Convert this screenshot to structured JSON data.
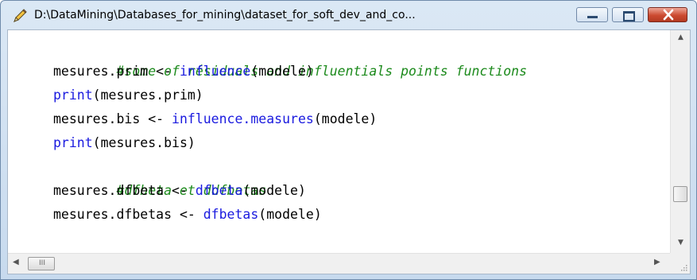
{
  "window": {
    "title": "D:\\DataMining\\Databases_for_mining\\dataset_for_soft_dev_and_co...",
    "icon": "pencil-edit-icon"
  },
  "controls": {
    "minimize_icon": "minimize-icon",
    "maximize_icon": "maximize-icon",
    "close_icon": "close-icon",
    "close_color": "#c9472e"
  },
  "colors": {
    "comment": "#1c8a1c",
    "function": "#1a1adf",
    "text": "#000000"
  },
  "editor": {
    "lines": [
      {
        "comment": "#some of résiduals and influentials points functions"
      },
      {
        "pre": "mesures.prim <- ",
        "fn": "influence",
        "post": "(modele)"
      },
      {
        "pre": "",
        "fn": "print",
        "post": "(mesures.prim)"
      },
      {
        "pre": "mesures.bis <- ",
        "fn": "influence.measures",
        "post": "(modele)"
      },
      {
        "pre": "",
        "fn": "print",
        "post": "(mesures.bis)"
      },
      {
        "comment": "#dfbeta et ddfbetas"
      },
      {
        "pre": "mesures.dfbeta <- ",
        "fn": "dfbeta",
        "post": "(modele)"
      },
      {
        "pre": "mesures.dfbetas <- ",
        "fn": "dfbetas",
        "post": "(modele)"
      }
    ]
  },
  "scrollbars": {
    "up_arrow": "▲",
    "down_arrow": "▼",
    "left_arrow": "◀",
    "right_arrow": "▶",
    "h_thumb_grip": "III",
    "vertical_position": 0.75,
    "horizontal_position": 0.0
  }
}
